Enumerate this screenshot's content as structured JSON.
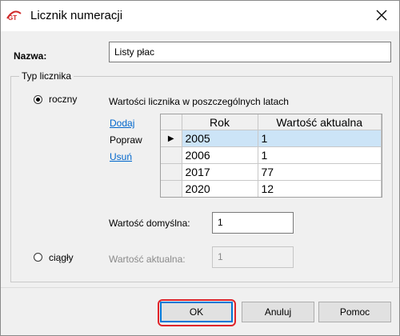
{
  "window": {
    "title": "Licznik numeracji",
    "logo_icon": "gt-app-icon",
    "close_icon": "close-icon"
  },
  "form": {
    "name_label": "Nazwa:",
    "name_value": "Listy płac",
    "group_label": "Typ licznika",
    "option_yearly": "roczny",
    "option_continuous": "ciągły",
    "yearly_selected": true,
    "values_caption": "Wartości licznika w poszczególnych latach",
    "actions": {
      "add": "Dodaj",
      "edit": "Popraw",
      "delete": "Usuń"
    },
    "table": {
      "headers": [
        "Rok",
        "Wartość aktualna"
      ],
      "rows": [
        {
          "year": "2005",
          "value": "1",
          "selected": true
        },
        {
          "year": "2006",
          "value": "1",
          "selected": false
        },
        {
          "year": "2017",
          "value": "77",
          "selected": false
        },
        {
          "year": "2020",
          "value": "12",
          "selected": false
        }
      ]
    },
    "default_value_label": "Wartość domyślna:",
    "default_value": "1",
    "current_value_label": "Wartość aktualna:",
    "current_value": "1"
  },
  "buttons": {
    "ok": "OK",
    "cancel": "Anuluj",
    "help": "Pomoc"
  },
  "colors": {
    "accent": "#0078d7",
    "link": "#0066cc",
    "highlight": "#e0242a",
    "row_selected": "#cce4f7"
  }
}
